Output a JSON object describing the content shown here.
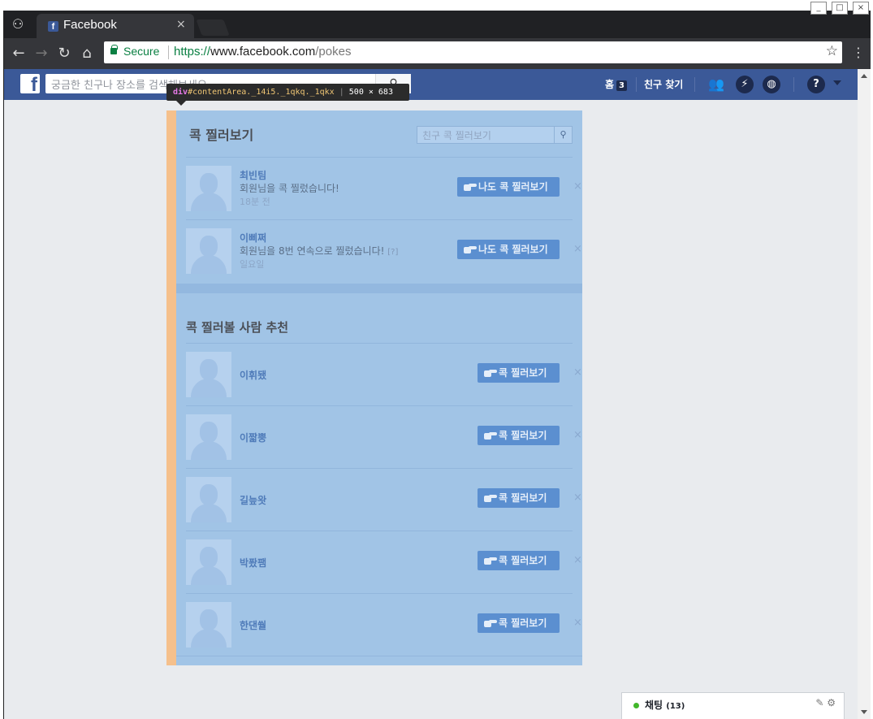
{
  "browser": {
    "tab_title": "Facebook",
    "tab_favicon": "f",
    "tab_close": "×",
    "incognito_icon": "incognito-icon",
    "security_label": "Secure",
    "url_scheme": "https://",
    "url_host": "www.facebook.com",
    "url_path": "/pokes"
  },
  "fb_header": {
    "logo": "f",
    "search_placeholder": "궁금한 친구나 장소를 검색해보세요",
    "home_label": "홈",
    "home_badge": "3",
    "find_friends": "친구 찾기",
    "help_icon": "?"
  },
  "inspector": {
    "tag": "div",
    "selector": "#contentArea._14i5._1qkq._1qkx",
    "dims": "500 × 683"
  },
  "pokes": {
    "title": "콕 찔러보기",
    "search_placeholder": "친구 콕 찔러보기",
    "items": [
      {
        "name": "최빈팀",
        "message": "회원님을 콕 찔렀습니다!",
        "help": "",
        "time": "18분 전",
        "button": "나도 콕 찔러보기",
        "dismiss": "×"
      },
      {
        "name": "이삐쩌",
        "message": "회원님을 8번 연속으로 찔렀습니다!",
        "help": "[?]",
        "time": "일요일",
        "button": "나도 콕 찔러보기",
        "dismiss": "×"
      }
    ]
  },
  "suggestions": {
    "title": "콕 찔러볼 사람 추천",
    "items": [
      {
        "name": "이휘됐",
        "button": "콕 찔러보기",
        "dismiss": "×"
      },
      {
        "name": "이짧뿡",
        "button": "콕 찔러보기",
        "dismiss": "×"
      },
      {
        "name": "길늪왓",
        "button": "콕 찔러보기",
        "dismiss": "×"
      },
      {
        "name": "박퐜팸",
        "button": "콕 찔러보기",
        "dismiss": "×"
      },
      {
        "name": "한댄쒈",
        "button": "콕 찔러보기",
        "dismiss": "×"
      }
    ]
  },
  "chat": {
    "label": "채팅",
    "count": "(13)"
  },
  "colors": {
    "facebook_blue": "#3b5998",
    "highlight_content": "#a1c4e6",
    "highlight_padding": "#f5c08c",
    "chat_online": "#42b72a"
  }
}
